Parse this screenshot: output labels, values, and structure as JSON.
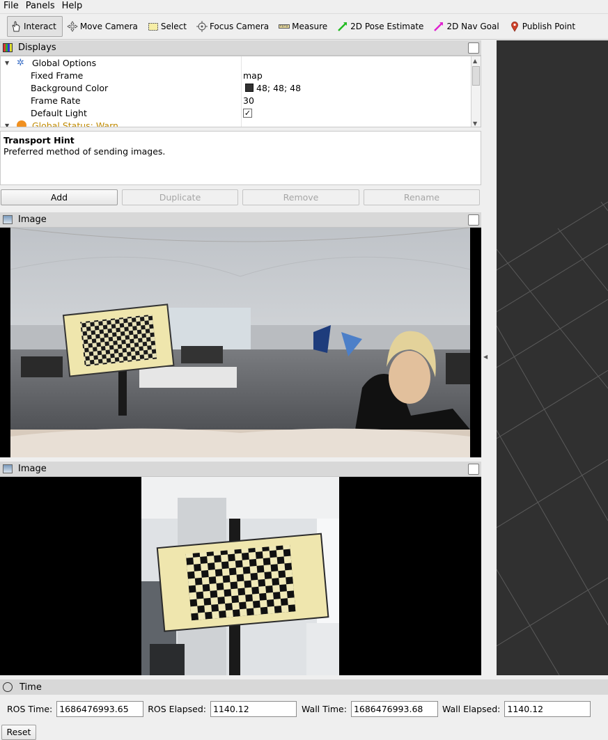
{
  "menu": [
    "File",
    "Panels",
    "Help"
  ],
  "toolbar": {
    "tools": [
      {
        "label": "Interact",
        "icon": "hand-icon",
        "active": true
      },
      {
        "label": "Move Camera",
        "icon": "move-camera-icon"
      },
      {
        "label": "Select",
        "icon": "select-icon"
      },
      {
        "label": "Focus Camera",
        "icon": "focus-camera-icon"
      },
      {
        "label": "Measure",
        "icon": "ruler-icon"
      },
      {
        "label": "2D Pose Estimate",
        "icon": "green-arrow-icon"
      },
      {
        "label": "2D Nav Goal",
        "icon": "magenta-arrow-icon"
      },
      {
        "label": "Publish Point",
        "icon": "map-pin-icon"
      }
    ]
  },
  "displays": {
    "title": "Displays",
    "global_options": "Global Options",
    "props": [
      {
        "name": "Fixed Frame",
        "value": "map"
      },
      {
        "name": "Background Color",
        "value": "48; 48; 48",
        "swatch": "#303030"
      },
      {
        "name": "Frame Rate",
        "value": "30"
      },
      {
        "name": "Default Light",
        "value": "✓"
      }
    ],
    "global_status": "Global Status: Warn"
  },
  "hint": {
    "title": "Transport Hint",
    "description": "Preferred method of sending images."
  },
  "buttons": {
    "add": "Add",
    "duplicate": "Duplicate",
    "remove": "Remove",
    "rename": "Rename"
  },
  "image_panel_1": {
    "title": "Image"
  },
  "image_panel_2": {
    "title": "Image"
  },
  "time": {
    "title": "Time",
    "ros_time_label": "ROS Time:",
    "ros_time": "1686476993.65",
    "ros_elapsed_label": "ROS Elapsed:",
    "ros_elapsed": "1140.12",
    "wall_time_label": "Wall Time:",
    "wall_time": "1686476993.68",
    "wall_elapsed_label": "Wall Elapsed:",
    "wall_elapsed": "1140.12",
    "reset": "Reset"
  },
  "colors": {
    "view_bg": "#303030",
    "warn": "#e0a000"
  }
}
